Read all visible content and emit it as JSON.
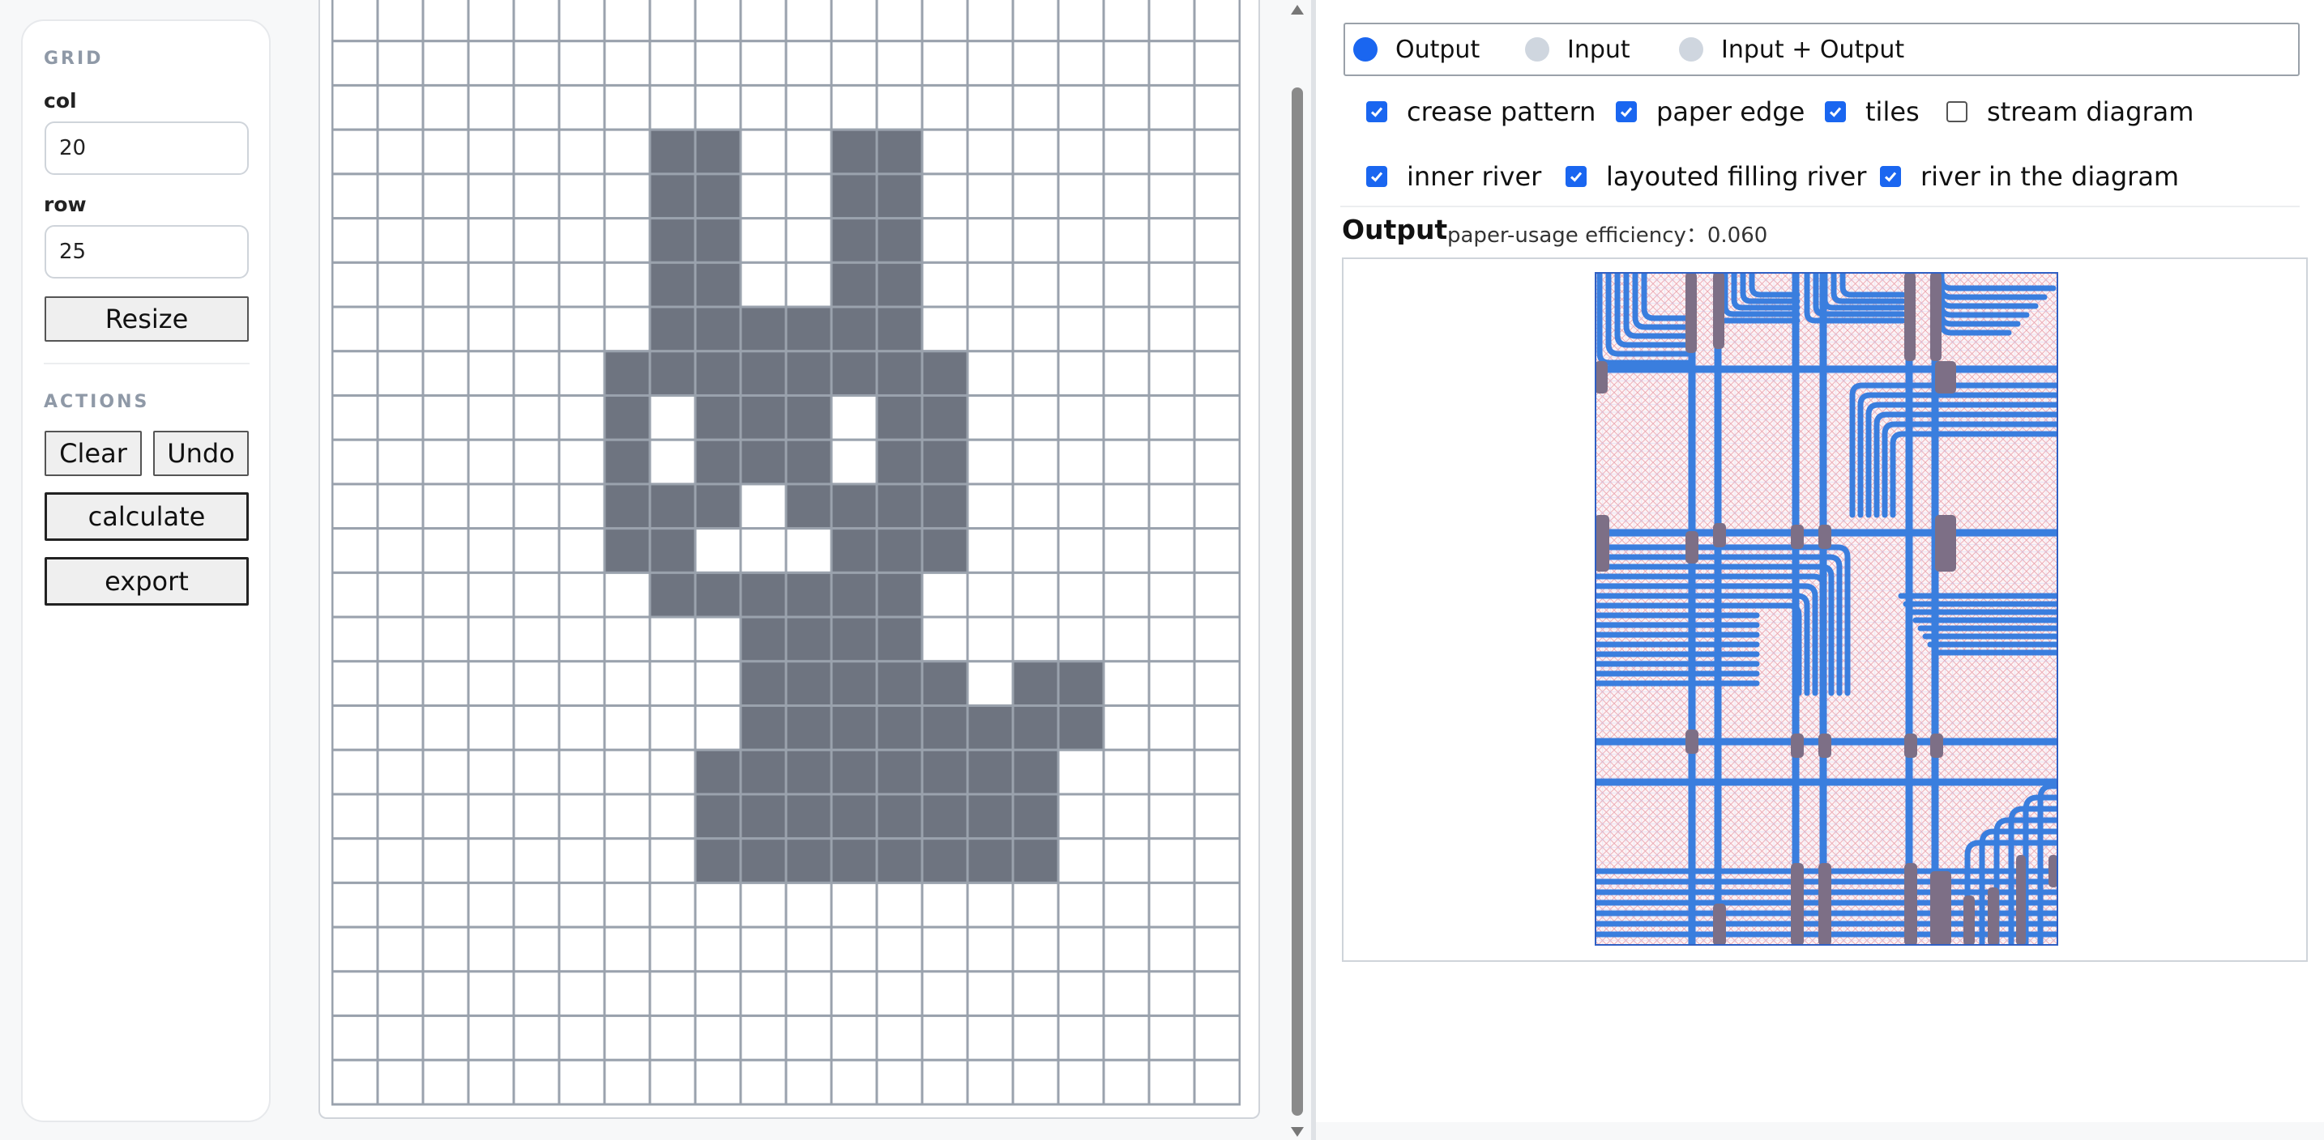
{
  "sidebar": {
    "grid_title": "GRID",
    "col_label": "col",
    "col_value": "20",
    "row_label": "row",
    "row_value": "25",
    "resize_label": "Resize",
    "actions_title": "ACTIONS",
    "clear_label": "Clear",
    "undo_label": "Undo",
    "calculate_label": "calculate",
    "export_label": "export"
  },
  "grid": {
    "cols": 20,
    "rows": 25,
    "filled_color": "#6e7480",
    "line_color": "#9aa2ad",
    "filled_cells": [
      [
        3,
        7
      ],
      [
        3,
        8
      ],
      [
        3,
        11
      ],
      [
        3,
        12
      ],
      [
        4,
        7
      ],
      [
        4,
        8
      ],
      [
        4,
        11
      ],
      [
        4,
        12
      ],
      [
        5,
        7
      ],
      [
        5,
        8
      ],
      [
        5,
        11
      ],
      [
        5,
        12
      ],
      [
        6,
        7
      ],
      [
        6,
        8
      ],
      [
        6,
        11
      ],
      [
        6,
        12
      ],
      [
        7,
        7
      ],
      [
        7,
        8
      ],
      [
        7,
        9
      ],
      [
        7,
        10
      ],
      [
        7,
        11
      ],
      [
        7,
        12
      ],
      [
        8,
        6
      ],
      [
        8,
        7
      ],
      [
        8,
        8
      ],
      [
        8,
        9
      ],
      [
        8,
        10
      ],
      [
        8,
        11
      ],
      [
        8,
        12
      ],
      [
        8,
        13
      ],
      [
        9,
        6
      ],
      [
        9,
        8
      ],
      [
        9,
        9
      ],
      [
        9,
        10
      ],
      [
        9,
        12
      ],
      [
        9,
        13
      ],
      [
        10,
        6
      ],
      [
        10,
        8
      ],
      [
        10,
        9
      ],
      [
        10,
        10
      ],
      [
        10,
        12
      ],
      [
        10,
        13
      ],
      [
        11,
        6
      ],
      [
        11,
        7
      ],
      [
        11,
        8
      ],
      [
        11,
        10
      ],
      [
        11,
        11
      ],
      [
        11,
        12
      ],
      [
        11,
        13
      ],
      [
        12,
        6
      ],
      [
        12,
        7
      ],
      [
        12,
        11
      ],
      [
        12,
        12
      ],
      [
        12,
        13
      ],
      [
        13,
        7
      ],
      [
        13,
        8
      ],
      [
        13,
        9
      ],
      [
        13,
        10
      ],
      [
        13,
        11
      ],
      [
        13,
        12
      ],
      [
        14,
        9
      ],
      [
        14,
        10
      ],
      [
        14,
        11
      ],
      [
        14,
        12
      ],
      [
        15,
        9
      ],
      [
        15,
        10
      ],
      [
        15,
        11
      ],
      [
        15,
        12
      ],
      [
        15,
        13
      ],
      [
        15,
        15
      ],
      [
        15,
        16
      ],
      [
        16,
        9
      ],
      [
        16,
        10
      ],
      [
        16,
        11
      ],
      [
        16,
        12
      ],
      [
        16,
        13
      ],
      [
        16,
        14
      ],
      [
        16,
        15
      ],
      [
        16,
        16
      ],
      [
        17,
        8
      ],
      [
        17,
        9
      ],
      [
        17,
        10
      ],
      [
        17,
        11
      ],
      [
        17,
        12
      ],
      [
        17,
        13
      ],
      [
        17,
        14
      ],
      [
        17,
        15
      ],
      [
        18,
        8
      ],
      [
        18,
        9
      ],
      [
        18,
        10
      ],
      [
        18,
        11
      ],
      [
        18,
        12
      ],
      [
        18,
        13
      ],
      [
        18,
        14
      ],
      [
        18,
        15
      ],
      [
        19,
        8
      ],
      [
        19,
        9
      ],
      [
        19,
        10
      ],
      [
        19,
        11
      ],
      [
        19,
        12
      ],
      [
        19,
        13
      ],
      [
        19,
        14
      ],
      [
        19,
        15
      ]
    ]
  },
  "view": {
    "modes": [
      {
        "label": "Output",
        "selected": true
      },
      {
        "label": "Input",
        "selected": false
      },
      {
        "label": "Input + Output",
        "selected": false
      }
    ],
    "checkboxes": [
      {
        "label": "crease pattern",
        "checked": true
      },
      {
        "label": "paper edge",
        "checked": true
      },
      {
        "label": "tiles",
        "checked": true
      },
      {
        "label": "stream diagram",
        "checked": false
      },
      {
        "label": "inner river",
        "checked": true
      },
      {
        "label": "layouted filling river",
        "checked": true
      },
      {
        "label": "river in the diagram",
        "checked": true
      }
    ]
  },
  "output": {
    "title": "Output",
    "efficiency_text": "paper-usage efficiency：0.060"
  },
  "colors": {
    "accent": "#1a66f0",
    "river": "#3a7ede",
    "crease": "#e06a7a",
    "flap": "#7d6f86"
  }
}
